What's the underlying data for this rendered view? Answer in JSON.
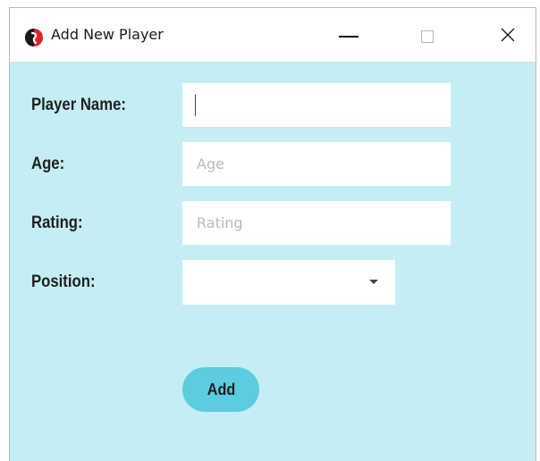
{
  "window": {
    "title": "Add New Player",
    "app_icon": "red-black-circle-logo-icon",
    "controls": {
      "minimize_icon": "minimize-icon",
      "maximize_icon": "maximize-icon",
      "close_icon": "close-icon",
      "close_glyph": "✕"
    }
  },
  "form": {
    "player_name": {
      "label": "Player Name:",
      "value": "",
      "placeholder": ""
    },
    "age": {
      "label": "Age:",
      "value": "",
      "placeholder": "Age"
    },
    "rating": {
      "label": "Rating:",
      "value": "",
      "placeholder": "Rating"
    },
    "position": {
      "label": "Position:",
      "selected": ""
    },
    "add_button_label": "Add"
  },
  "colors": {
    "window_background": "#c4eef3",
    "titlebar_background": "#ffffff",
    "button_background": "#5ccddf",
    "icon_red": "#d9252a",
    "icon_black": "#1a1a1a"
  }
}
